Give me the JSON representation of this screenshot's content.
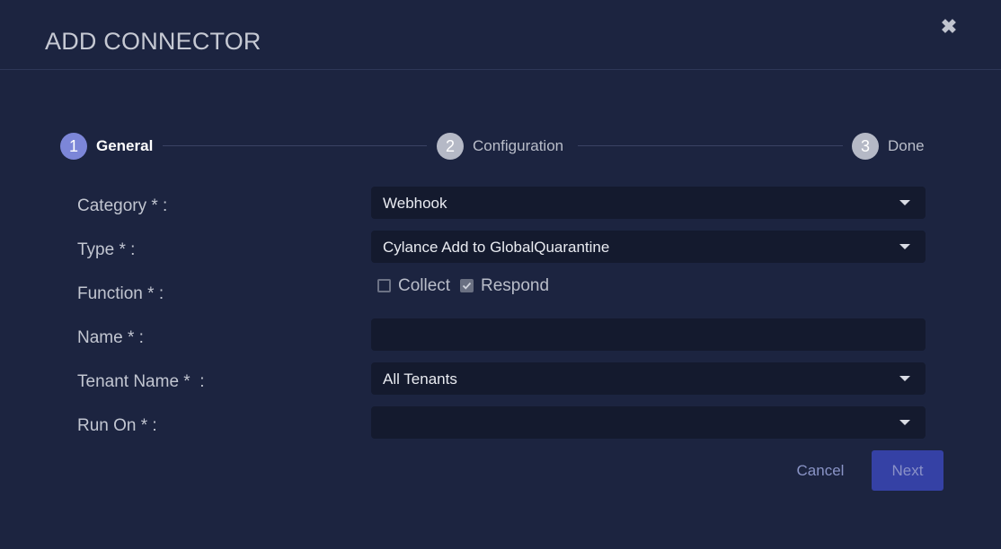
{
  "dialog": {
    "title": "ADD CONNECTOR",
    "close_icon": "close-icon"
  },
  "stepper": {
    "steps": [
      {
        "number": "1",
        "label": "General",
        "active": true
      },
      {
        "number": "2",
        "label": "Configuration",
        "active": false
      },
      {
        "number": "3",
        "label": "Done",
        "active": false
      }
    ]
  },
  "form": {
    "category": {
      "label": "Category * :",
      "value": "Webhook"
    },
    "type": {
      "label": "Type * :",
      "value": "Cylance Add to GlobalQuarantine"
    },
    "function": {
      "label": "Function * :",
      "options": [
        {
          "label": "Collect",
          "checked": false,
          "disabled": false
        },
        {
          "label": "Respond",
          "checked": true,
          "disabled": true
        }
      ]
    },
    "name": {
      "label": "Name * :",
      "value": ""
    },
    "tenant": {
      "label": "Tenant Name *  :",
      "value": "All Tenants"
    },
    "run_on": {
      "label": "Run On * :",
      "value": ""
    }
  },
  "actions": {
    "cancel_label": "Cancel",
    "next_label": "Next"
  },
  "colors": {
    "background": "#1c2440",
    "field_bg": "#141a2e",
    "active_step": "#7c86d8",
    "inactive_step": "#b5b9c6",
    "next_button": "#3541a5"
  }
}
